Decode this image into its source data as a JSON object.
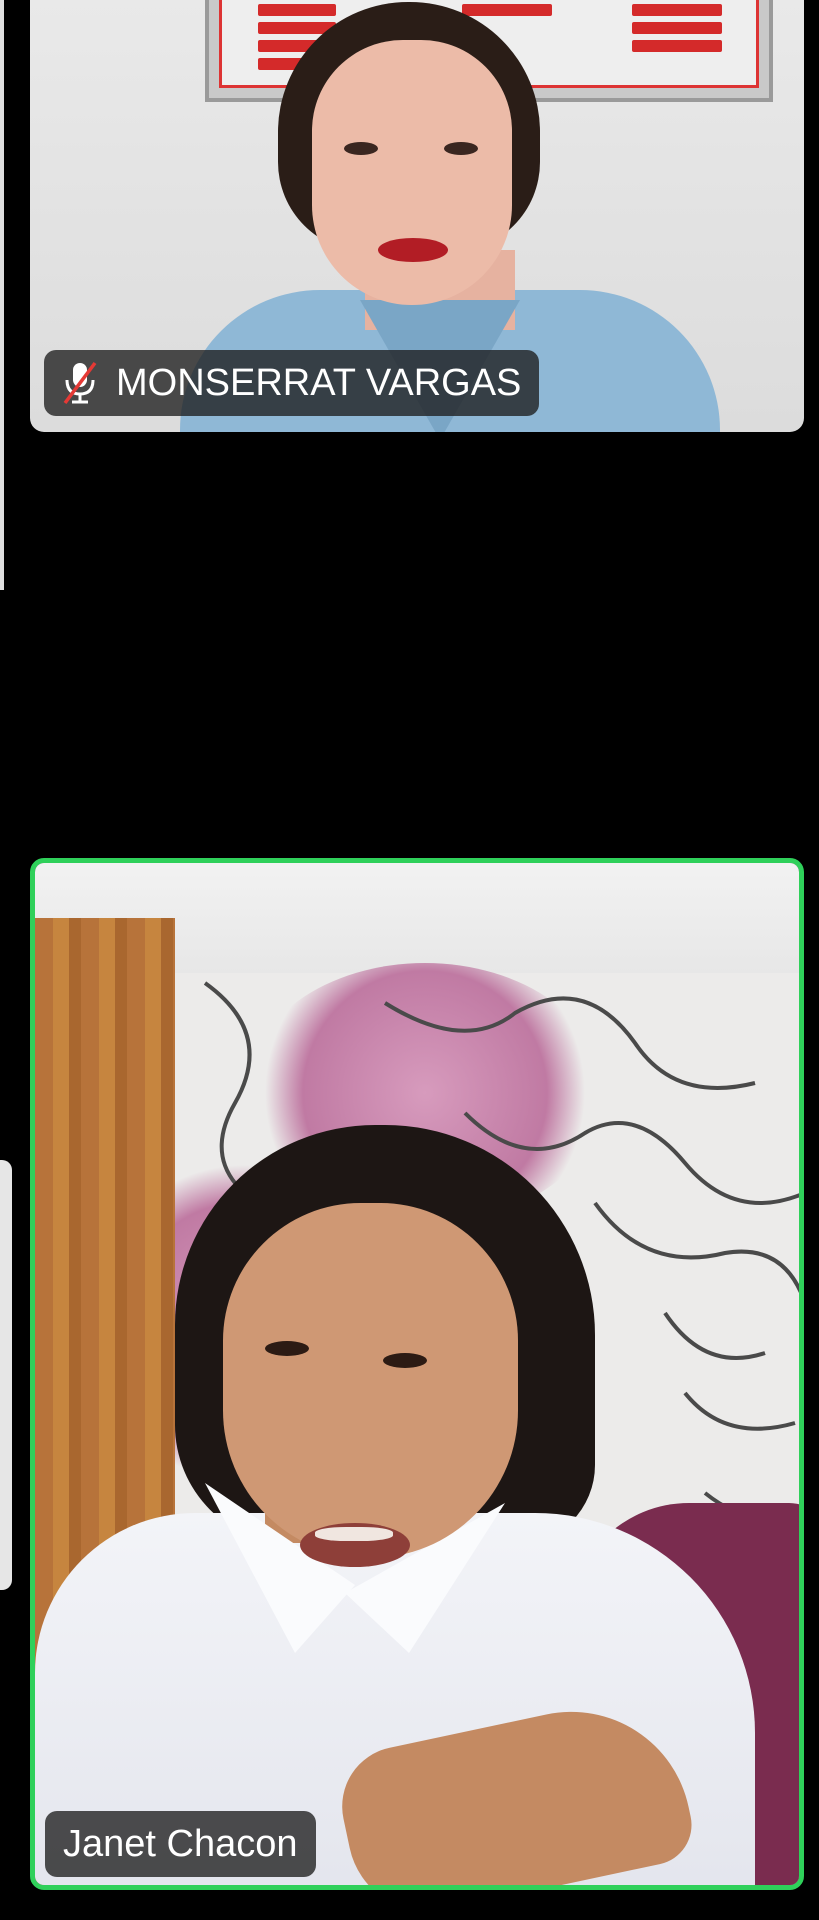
{
  "participants": [
    {
      "name": "MONSERRAT VARGAS",
      "muted": true,
      "mic_icon": "mic-muted-icon",
      "active_speaker": false
    },
    {
      "name": "Janet Chacon",
      "muted": false,
      "active_speaker": true
    }
  ],
  "colors": {
    "background": "#000000",
    "active_speaker_border": "#2fd05a",
    "name_tag_bg": "rgba(30,30,30,0.78)",
    "muted_slash": "#e53935"
  }
}
